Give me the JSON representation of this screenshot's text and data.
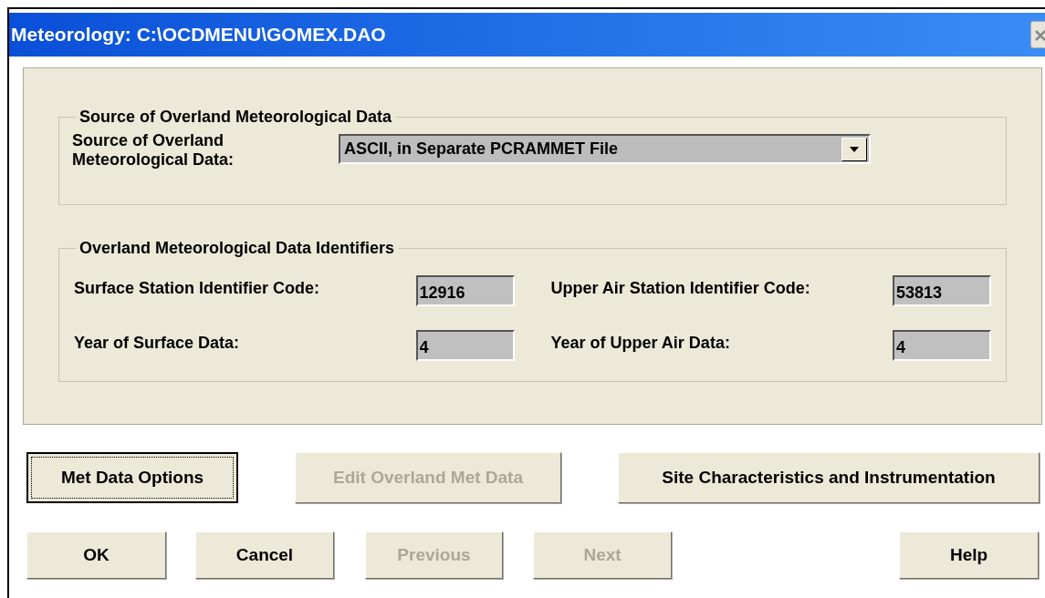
{
  "window": {
    "title": "Meteorology: C:\\OCDMENU\\GOMEX.DAO"
  },
  "source_group": {
    "title": "Source of Overland Meteorological Data",
    "label": "Source of Overland Meteorological Data:",
    "dropdown": {
      "value": "ASCII, in Separate PCRAMMET File"
    }
  },
  "identifiers_group": {
    "title": "Overland Meteorological Data Identifiers",
    "fields": [
      {
        "label": "Surface Station Identifier Code:",
        "value": "12916"
      },
      {
        "label": "Upper Air Station Identifier Code:",
        "value": "53813"
      },
      {
        "label": "Year of Surface Data:",
        "value": "4"
      },
      {
        "label": "Year of Upper Air Data:",
        "value": "4"
      }
    ]
  },
  "option_buttons": [
    {
      "label": "Met Data Options",
      "disabled": false,
      "focused": true
    },
    {
      "label": "Edit Overland Met Data",
      "disabled": true,
      "focused": false
    },
    {
      "label": "Site Characteristics and Instrumentation",
      "disabled": false,
      "focused": false
    }
  ],
  "dialog_buttons": [
    {
      "label": "OK",
      "disabled": false
    },
    {
      "label": "Cancel",
      "disabled": false
    },
    {
      "label": "Previous",
      "disabled": true
    },
    {
      "label": "Next",
      "disabled": true
    },
    {
      "label": "Help",
      "disabled": false
    }
  ]
}
